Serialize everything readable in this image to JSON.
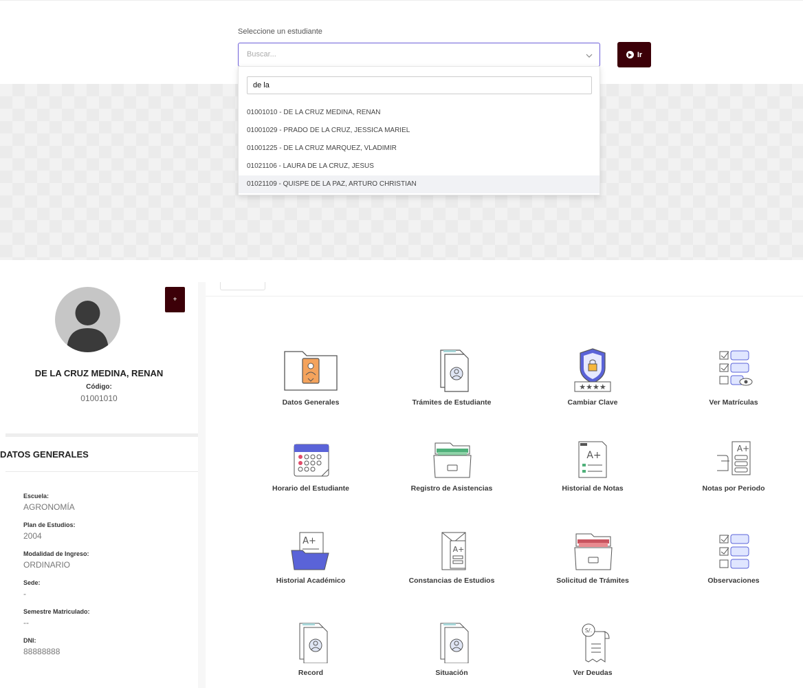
{
  "search": {
    "label": "Seleccione un estudiante",
    "placeholder": "Buscar...",
    "query": "de la",
    "go_label": "Ir",
    "results": [
      "01001010 - DE LA CRUZ MEDINA, RENAN",
      "01001029 - PRADO DE LA CRUZ, JESSICA MARIEL",
      "01001225 - DE LA CRUZ MARQUEZ, VLADIMIR",
      "01021106 - LAURA DE LA CRUZ, JESUS",
      "01021109 - QUISPE DE LA PAZ, ARTURO CHRISTIAN"
    ]
  },
  "profile": {
    "plus_label": "+",
    "name": "DE LA CRUZ MEDINA, RENAN",
    "code_label": "Código:",
    "code": "01001010"
  },
  "general": {
    "title": "DATOS GENERALES",
    "fields": [
      {
        "label": "Escuela:",
        "value": "AGRONOMÍA"
      },
      {
        "label": "Plan de Estudios:",
        "value": "2004"
      },
      {
        "label": "Modalidad de Ingreso:",
        "value": "ORDINARIO"
      },
      {
        "label": "Sede:",
        "value": "-"
      },
      {
        "label": "Semestre Matriculado:",
        "value": "--"
      },
      {
        "label": "DNI:",
        "value": "88888888"
      }
    ]
  },
  "menu": [
    {
      "label": "Datos Generales",
      "icon": "folder-user-icon"
    },
    {
      "label": "Trámites de Estudiante",
      "icon": "document-user-icon"
    },
    {
      "label": "Cambiar Clave",
      "icon": "shield-lock-icon"
    },
    {
      "label": "Ver Matrículas",
      "icon": "checklist-eye-icon"
    },
    {
      "label": "Horario del Estudiante",
      "icon": "calendar-icon"
    },
    {
      "label": "Registro de Asistencias",
      "icon": "file-drawer-icon"
    },
    {
      "label": "Historial de Notas",
      "icon": "grade-report-icon"
    },
    {
      "label": "Notas por Periodo",
      "icon": "grade-checklist-icon"
    },
    {
      "label": "Historial Académico",
      "icon": "folder-grades-icon"
    },
    {
      "label": "Constancias de Estudios",
      "icon": "envelope-grades-icon"
    },
    {
      "label": "Solicitud de Trámites",
      "icon": "drawer-request-icon"
    },
    {
      "label": "Observaciones",
      "icon": "checklist-icon"
    },
    {
      "label": "Record",
      "icon": "document-user-icon"
    },
    {
      "label": "Situación",
      "icon": "document-user-icon"
    },
    {
      "label": "Ver Deudas",
      "icon": "receipt-icon"
    }
  ],
  "colors": {
    "primary": "#3c0008",
    "accent": "#6d5ed8",
    "icon_blue": "#5a63d8"
  }
}
